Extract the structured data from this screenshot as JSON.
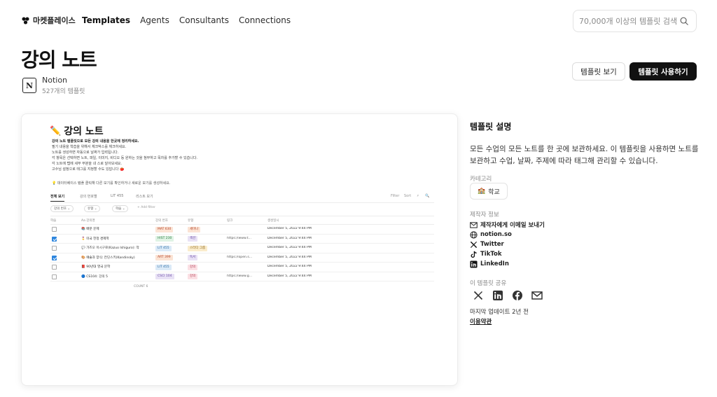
{
  "nav": {
    "brand_label": "마켓플레이스",
    "links": [
      "Templates",
      "Agents",
      "Consultants",
      "Connections"
    ],
    "search_placeholder": "70,000개 이상의 템플릿 검색"
  },
  "page": {
    "title": "강의 노트",
    "publisher_name": "Notion",
    "publisher_count": "527개의 템플릿",
    "btn_preview": "템플릿 보기",
    "btn_use": "템플릿 사용하기"
  },
  "preview": {
    "title": "강의 노트",
    "desc_bold": "강의 노트 템플릿으로 모든 강의 내용을 한곳에 정리하세요.",
    "desc_lines": [
      "필기 내용을 학습을 위해서 체크박스를 체크하세요.",
      "노트를 생성하면 자동으로 날짜가 입력됩니다.",
      "각 항목은 선택하면 노트, 파일, 이미지, 비디오 등 원하는 것을 첨부하고 목차를 추가할 수 있습니다.",
      "각 노트에 탭에 세부 부분을 내 스로 달아보세요.",
      "고수님 설정으로 태그를 지정할 수도 있답니다 🍅"
    ],
    "note": "💡 데이터베이스 템플 클릭해 다른 보기를 확인하거나 새로운 보기를 생성하세요.",
    "tabs": [
      "전체 보기",
      "강의 번호별",
      "LIT 455",
      "리스트 보기"
    ],
    "tabs_right": [
      "Filter",
      "Sort",
      "⚡",
      "🔍"
    ],
    "filters": [
      "강의 번호 ⌄",
      "유형 ⌄",
      "학습 ⌄"
    ],
    "add_filter": "+ Add filter",
    "columns": [
      "학습",
      "Aa 강의명",
      "강의 번호",
      "유형",
      "링크",
      "생성일시"
    ],
    "rows": [
      {
        "done": false,
        "icon": "📚",
        "name": "배분 문제",
        "code": "MAT 630",
        "code_bg": "#fbe3d4",
        "code_fg": "#b5452a",
        "type": "세미나",
        "type_bg": "#fbe3d4",
        "type_fg": "#b5452a",
        "link": "",
        "date": "December 5, 2022 9:44 PM"
      },
      {
        "done": true,
        "icon": "🎖️",
        "name": "미국 헌정 경제학",
        "code": "HIST 230",
        "code_bg": "#dff3e4",
        "code_fg": "#2d7d46",
        "type": "섹션",
        "type_bg": "#e8e1f5",
        "type_fg": "#6b4ea6",
        "link": "https://www.t...",
        "date": "December 5, 2022 9:44 PM"
      },
      {
        "done": false,
        "icon": "💬",
        "name": "가즈오 이시구로(Kazuo Ishiguro): 작",
        "code": "LIT 455",
        "code_bg": "#dbeaf7",
        "code_fg": "#2a6aa3",
        "type": "스터디 그룹",
        "type_bg": "#faeccc",
        "type_fg": "#8a6210",
        "link": "",
        "date": "December 5, 2022 9:44 PM"
      },
      {
        "done": true,
        "icon": "🎨",
        "name": "예술과 양식: 칸딘스키(Kandinsky)",
        "code": "ART 399",
        "code_bg": "#fbe3d4",
        "code_fg": "#b5452a",
        "type": "독서",
        "type_bg": "#e8e1f5",
        "type_fg": "#6b4ea6",
        "link": "https://open.s...",
        "date": "December 5, 2022 9:44 PM"
      },
      {
        "done": false,
        "icon": "📕",
        "name": "90년대 영국 문학",
        "code": "LIT 455",
        "code_bg": "#dbeaf7",
        "code_fg": "#2a6aa3",
        "type": "강의",
        "type_bg": "#fbe0e4",
        "type_fg": "#b23a52",
        "link": "",
        "date": "December 5, 2022 9:44 PM"
      },
      {
        "done": false,
        "icon": "🔵",
        "name": "CS104: 강의 5",
        "code": "CSCI 104",
        "code_bg": "#e8e1f5",
        "code_fg": "#6b4ea6",
        "type": "강의",
        "type_bg": "#fbe0e4",
        "type_fg": "#b23a52",
        "link": "https://www.g...",
        "date": "December 5, 2022 9:44 PM"
      }
    ],
    "count_label": "COUNT 6"
  },
  "info": {
    "heading": "템플릿 설명",
    "description": "모든 수업의 모든 노트를 한 곳에 보관하세요. 이 템플릿을 사용하면 노트를 보관하고 수업, 날짜, 주제에 따라 태그해 관리할 수 있습니다.",
    "category_label": "카테고리",
    "category": "학교",
    "maker_label": "제작자 정보",
    "maker_links": [
      {
        "icon": "mail-icon",
        "label": "제작자에게 이메일 보내기"
      },
      {
        "icon": "globe-icon",
        "label": "notion.so"
      },
      {
        "icon": "x-icon",
        "label": "Twitter"
      },
      {
        "icon": "tiktok-icon",
        "label": "TikTok"
      },
      {
        "icon": "linkedin-icon",
        "label": "LinkedIn"
      }
    ],
    "share_label": "이 템플릿 공유",
    "updated": "마지막 업데이트 2년 전",
    "terms": "이용약관"
  }
}
